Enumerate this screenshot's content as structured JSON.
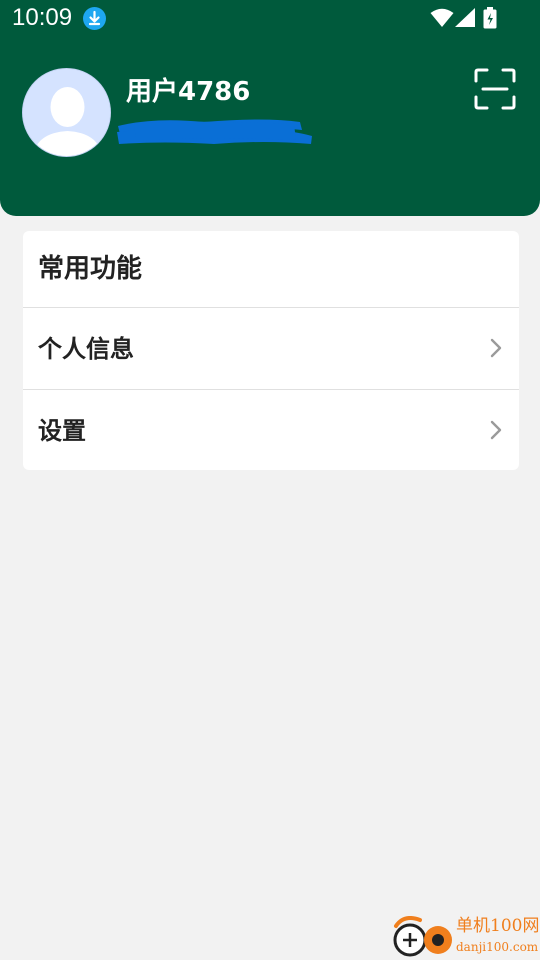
{
  "status_bar": {
    "time": "10:09",
    "icons": [
      "download-icon",
      "wifi-icon",
      "signal-icon",
      "battery-icon"
    ]
  },
  "profile": {
    "username": "用户4786",
    "subtitle_redacted": true,
    "avatar_icon": "default-avatar-icon",
    "scan_icon": "scan-icon"
  },
  "card": {
    "title": "常用功能",
    "items": [
      {
        "label": "个人信息",
        "icon": "chevron-right-icon"
      },
      {
        "label": "设置",
        "icon": "chevron-right-icon"
      }
    ]
  },
  "watermark": {
    "title": "单机100网",
    "url": "danji100.com"
  },
  "colors": {
    "header_bg": "#005a3c",
    "page_bg": "#f2f2f2",
    "card_bg": "#ffffff",
    "redaction": "#0a6fd6",
    "download_badge": "#1ea7f0",
    "watermark": "#f07f1d"
  }
}
